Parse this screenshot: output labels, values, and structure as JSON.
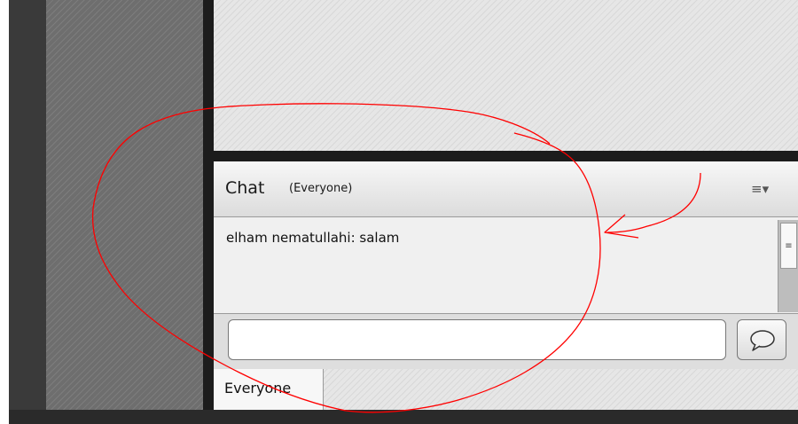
{
  "chat": {
    "title": "Chat",
    "scope": "(Everyone)",
    "menu_icon": "menu-list-icon",
    "messages": [
      {
        "text": "elham nematullahi: salam"
      }
    ],
    "input": {
      "value": "",
      "placeholder": ""
    },
    "send_icon": "chat-bubble-icon",
    "tabs": [
      {
        "label": "Everyone"
      }
    ]
  },
  "colors": {
    "annotation": "#ff0000",
    "divider": "#1c1c1c",
    "header_top": "#f7f7f7",
    "header_bottom": "#dcdcdc"
  }
}
